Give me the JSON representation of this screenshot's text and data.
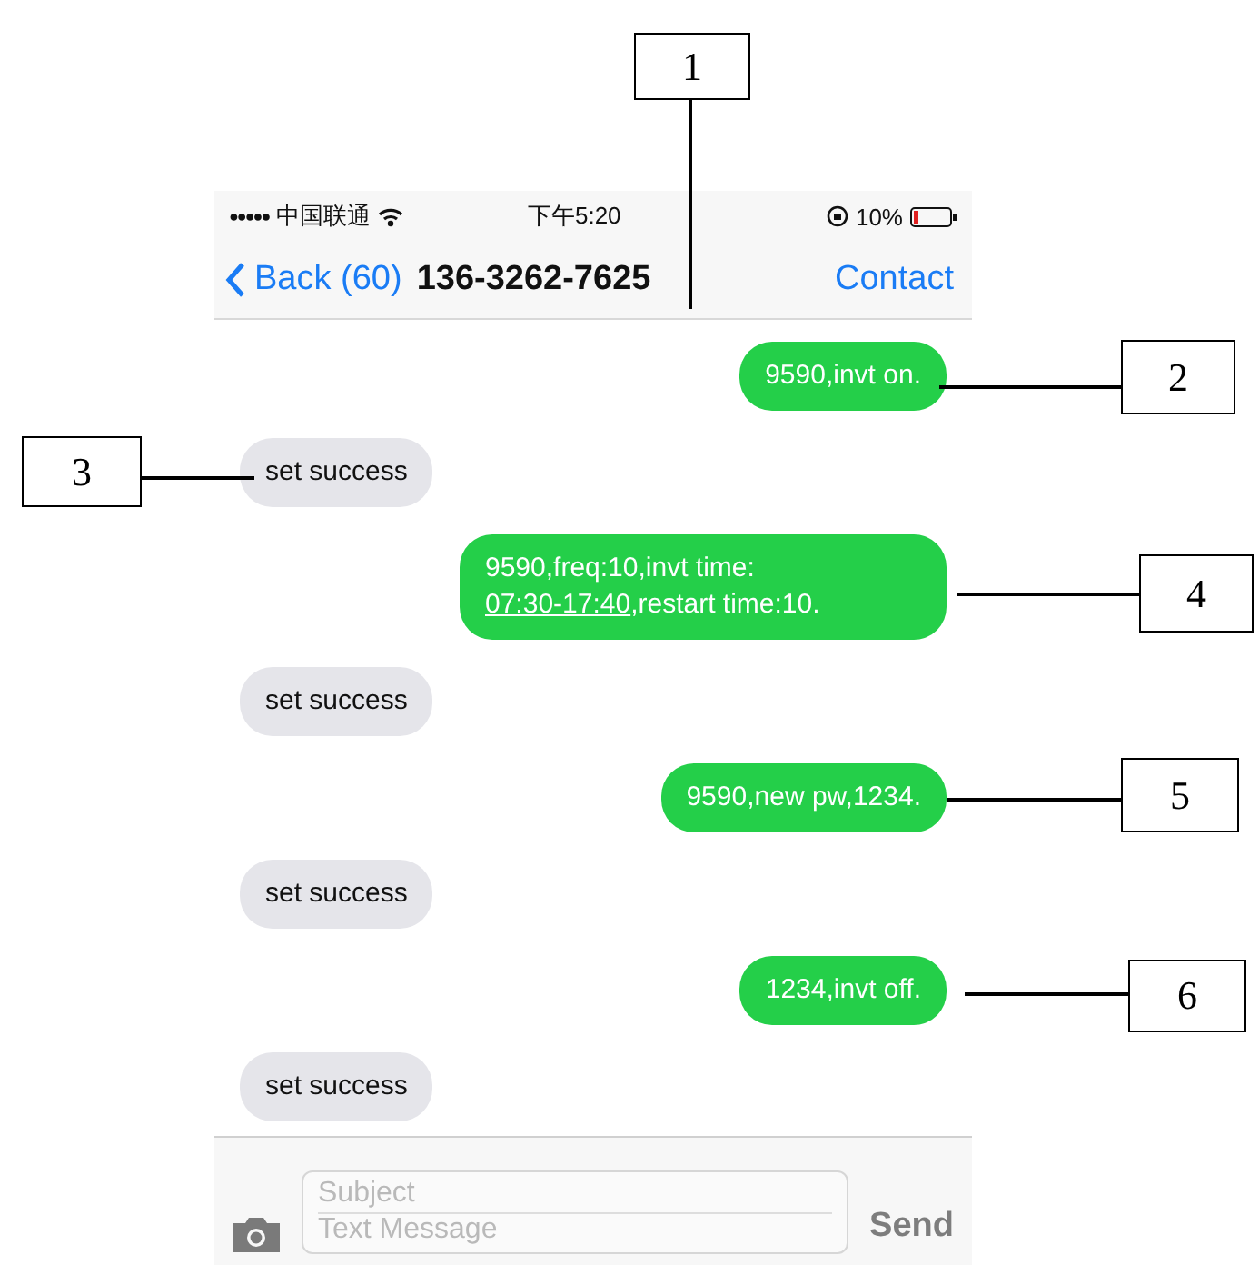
{
  "status_bar": {
    "signal": "●●●●●",
    "carrier": "中国联通",
    "time": "下午5:20",
    "battery_percent": "10%"
  },
  "nav": {
    "back": "Back (60)",
    "title": "136-3262-7625",
    "action": "Contact"
  },
  "messages": [
    {
      "kind": "sent",
      "segments": [
        {
          "text": "9590,invt on.",
          "link": false
        }
      ]
    },
    {
      "kind": "received",
      "segments": [
        {
          "text": "set success",
          "link": false
        }
      ]
    },
    {
      "kind": "sent",
      "segments": [
        {
          "text": "9590,freq:10,invt time: ",
          "link": false
        },
        {
          "text": "07:30-17:40",
          "link": true
        },
        {
          "text": ",restart time:10.",
          "link": false
        }
      ]
    },
    {
      "kind": "received",
      "segments": [
        {
          "text": "set success",
          "link": false
        }
      ]
    },
    {
      "kind": "sent",
      "segments": [
        {
          "text": "9590,new pw,1234.",
          "link": false
        }
      ]
    },
    {
      "kind": "received",
      "segments": [
        {
          "text": "set success",
          "link": false
        }
      ]
    },
    {
      "kind": "sent",
      "segments": [
        {
          "text": "1234,invt off.",
          "link": false
        }
      ]
    },
    {
      "kind": "received",
      "segments": [
        {
          "text": "set success",
          "link": false
        }
      ]
    }
  ],
  "composer": {
    "subject_placeholder": "Subject",
    "message_placeholder": "Text Message",
    "send": "Send"
  },
  "callouts": [
    {
      "label": "1"
    },
    {
      "label": "2"
    },
    {
      "label": "3"
    },
    {
      "label": "4"
    },
    {
      "label": "5"
    },
    {
      "label": "6"
    }
  ]
}
